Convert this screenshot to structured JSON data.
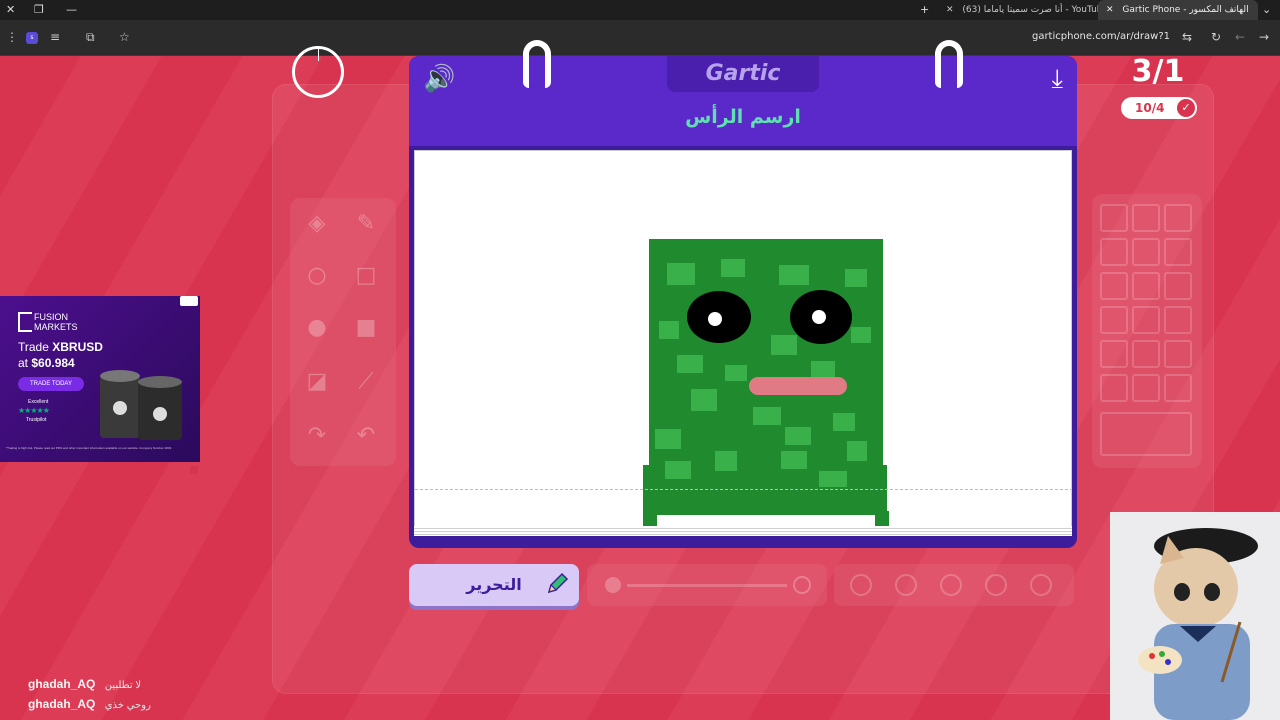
{
  "browser": {
    "tabs": [
      {
        "title": "Gartic Phone - الهاتف المكسور",
        "active": true
      },
      {
        "title": "(63) أنا صرت سميتا ياماما - YouTube",
        "active": false
      }
    ],
    "new_tab": "+",
    "url": "garticphone.com/ar/draw?1"
  },
  "game": {
    "logo": "Gartic",
    "instruction": "ارسم الرأس",
    "round": "3/1",
    "players": "10/4",
    "edit_button": "التحرير",
    "tools": [
      "eraser",
      "pencil",
      "circle-outline",
      "square-outline",
      "circle-filled",
      "square-filled",
      "bucket",
      "line",
      "undo",
      "redo"
    ]
  },
  "ad": {
    "brand_top": "FUSION",
    "brand_bottom": "MARKETS",
    "line1_prefix": "Trade ",
    "line1_bold": "XBRUSD",
    "line2_prefix": "at ",
    "line2_bold": "$60.984",
    "cta": "TRADE TODAY",
    "rating": "Excellent",
    "trustpilot": "Trustpilot",
    "fine_print": "*Trading is high risk. Please read our PDS and other important information available on our website. Company Number 4003."
  },
  "chat": [
    {
      "user": "ghadah_AQ",
      "message": "لا تطلبين"
    },
    {
      "user": "ghadah_AQ",
      "message": "روحي خذي"
    }
  ]
}
